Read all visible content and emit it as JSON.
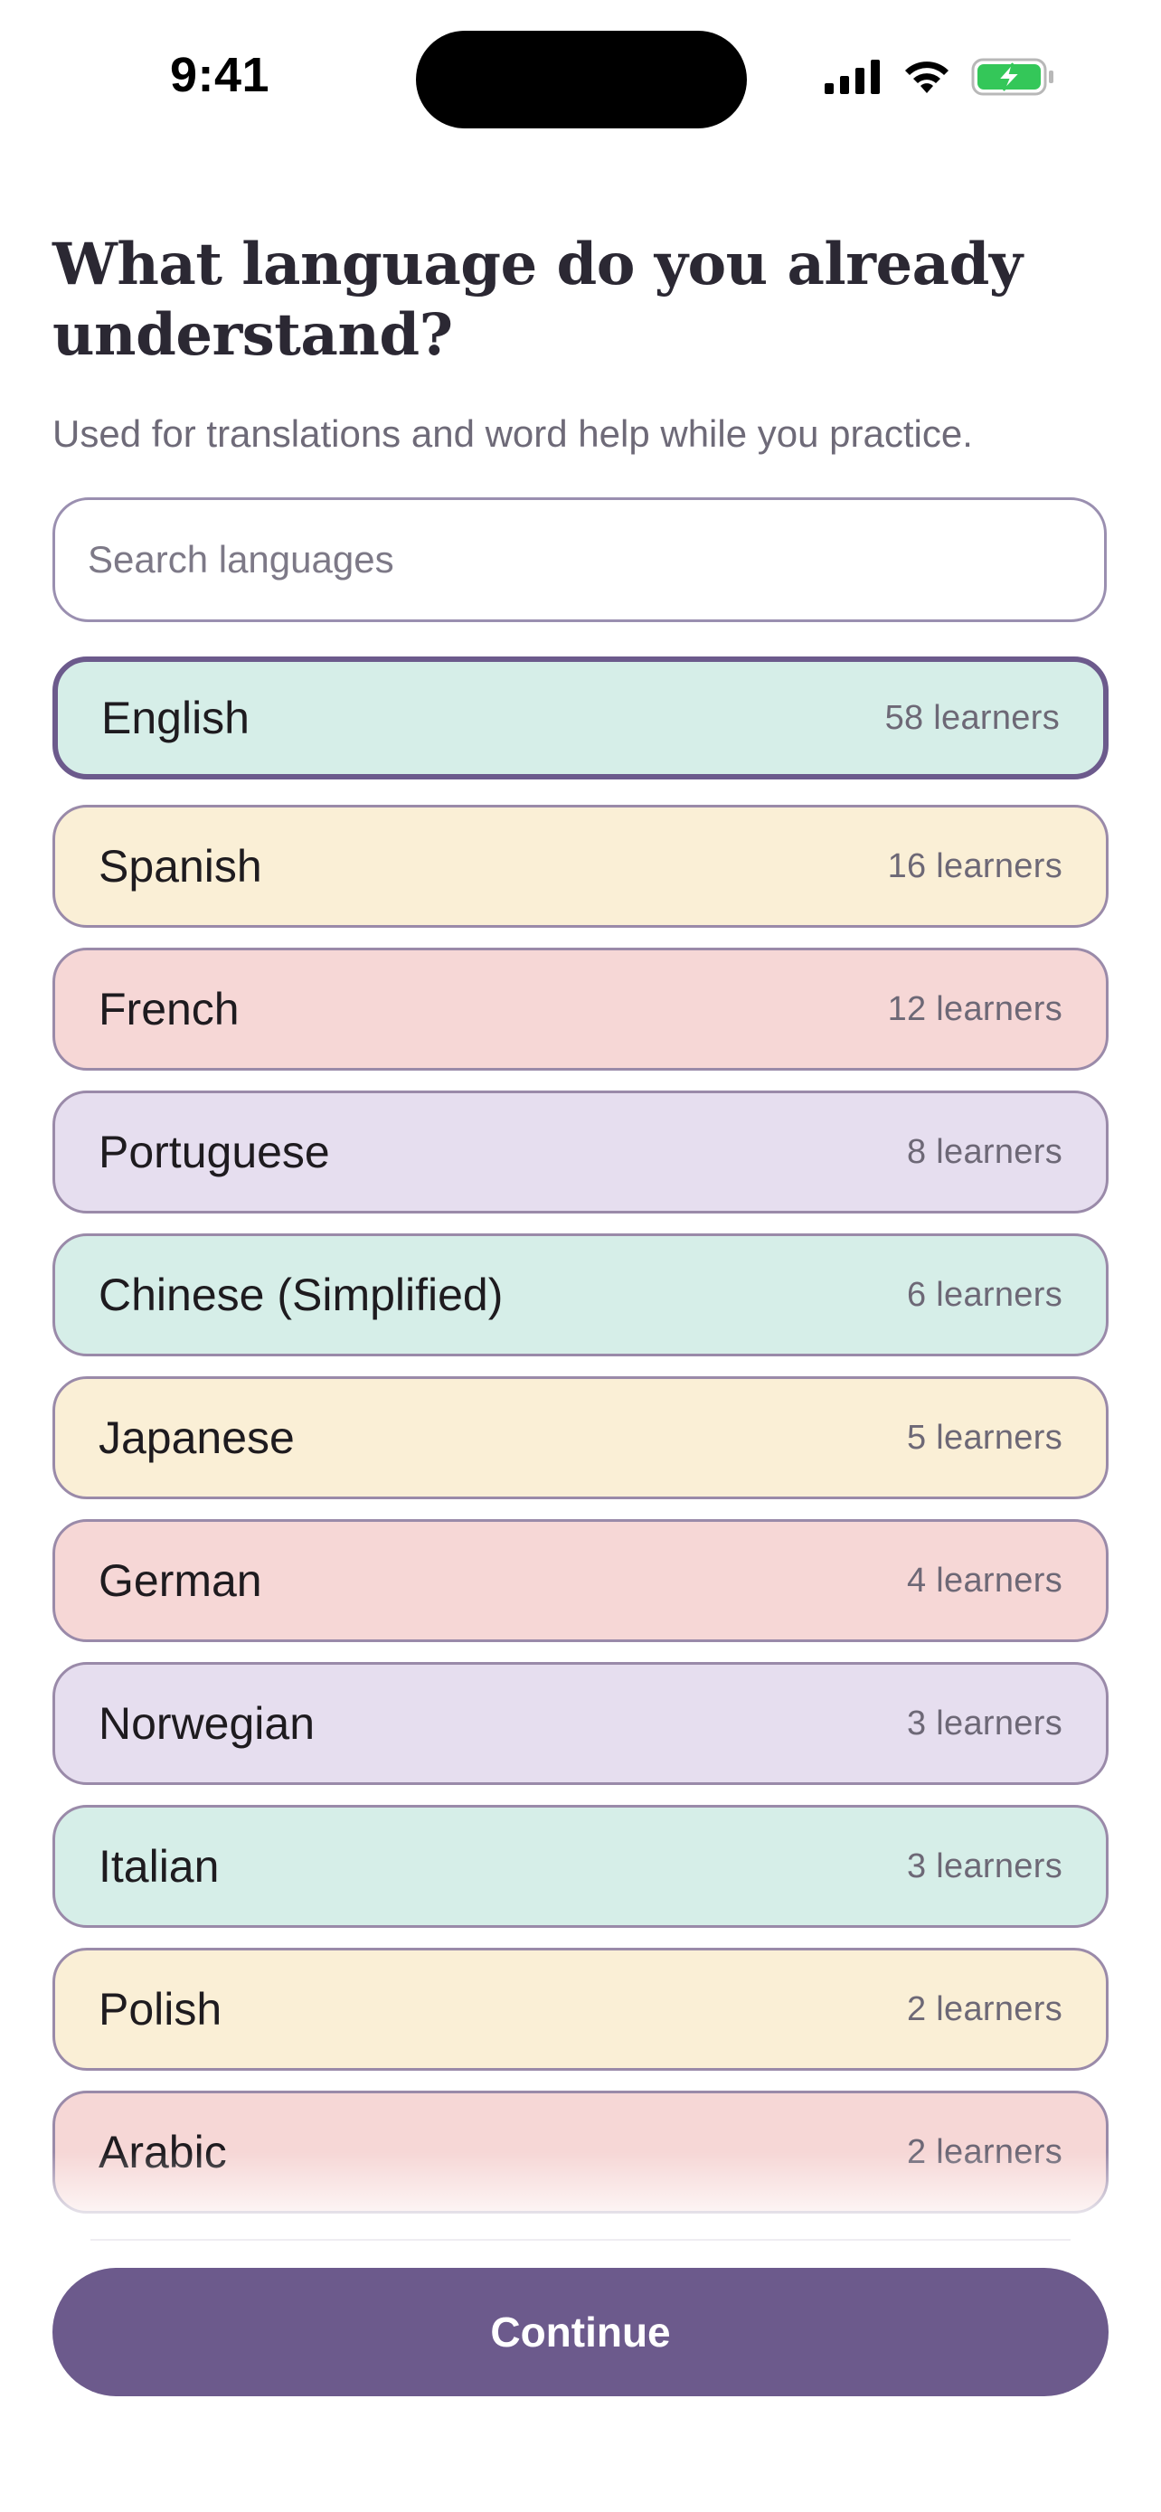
{
  "status_bar": {
    "time": "9:41",
    "icons": [
      "cellular-signal-icon",
      "wifi-icon",
      "battery-charging-icon"
    ],
    "battery_color": "#34c759"
  },
  "header": {
    "title": "What language do you already understand?",
    "subtitle": "Used for translations and word help while you practice."
  },
  "search": {
    "placeholder": "Search languages",
    "value": ""
  },
  "colors": {
    "accent": "#6c5a8c",
    "mint": "#d6eee8",
    "cream": "#faefd6",
    "rose": "#f6d7d6",
    "lavender": "#e6deef"
  },
  "languages": [
    {
      "name": "English",
      "count": "58 learners",
      "color": "#d6eee8",
      "selected": true
    },
    {
      "name": "Spanish",
      "count": "16 learners",
      "color": "#faefd6",
      "selected": false
    },
    {
      "name": "French",
      "count": "12 learners",
      "color": "#f6d7d6",
      "selected": false
    },
    {
      "name": "Portuguese",
      "count": "8 learners",
      "color": "#e6deef",
      "selected": false
    },
    {
      "name": "Chinese (Simplified)",
      "count": "6 learners",
      "color": "#d6eee8",
      "selected": false
    },
    {
      "name": "Japanese",
      "count": "5 learners",
      "color": "#faefd6",
      "selected": false
    },
    {
      "name": "German",
      "count": "4 learners",
      "color": "#f6d7d6",
      "selected": false
    },
    {
      "name": "Norwegian",
      "count": "3 learners",
      "color": "#e6deef",
      "selected": false
    },
    {
      "name": "Italian",
      "count": "3 learners",
      "color": "#d6eee8",
      "selected": false
    },
    {
      "name": "Polish",
      "count": "2 learners",
      "color": "#faefd6",
      "selected": false
    },
    {
      "name": "Arabic",
      "count": "2 learners",
      "color": "#f6d7d6",
      "selected": false
    }
  ],
  "continue_label": "Continue"
}
